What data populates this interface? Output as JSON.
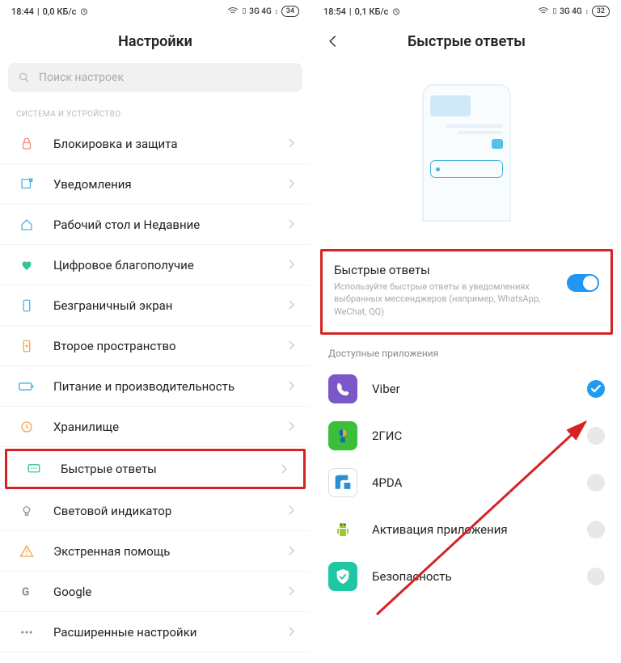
{
  "left": {
    "status": {
      "time": "18:44",
      "net": "0,0 КБ/с",
      "signals": "3G   4G",
      "battery": "34"
    },
    "title": "Настройки",
    "search_placeholder": "Поиск настроек",
    "section": "СИСТЕМА И УСТРОЙСТВО",
    "items": [
      {
        "label": "Блокировка и защита",
        "name": "settings-lock",
        "icon": "lock",
        "color": "#f08a7a"
      },
      {
        "label": "Уведомления",
        "name": "settings-notifications",
        "icon": "notif",
        "color": "#4fb8e8"
      },
      {
        "label": "Рабочий стол и Недавние",
        "name": "settings-home-recents",
        "icon": "home",
        "color": "#4fb8e8"
      },
      {
        "label": "Цифровое благополучие",
        "name": "settings-wellbeing",
        "icon": "heart",
        "color": "#2bc598"
      },
      {
        "label": "Безграничный экран",
        "name": "settings-fullscreen",
        "icon": "phone",
        "color": "#4fb8e8"
      },
      {
        "label": "Второе пространство",
        "name": "settings-second-space",
        "icon": "lock2",
        "color": "#f4a64a"
      },
      {
        "label": "Питание и производительность",
        "name": "settings-battery-perf",
        "icon": "batt",
        "color": "#4fb8e8"
      },
      {
        "label": "Хранилище",
        "name": "settings-storage",
        "icon": "store",
        "color": "#f4a64a"
      },
      {
        "label": "Быстрые ответы",
        "name": "settings-quick-replies",
        "icon": "chat",
        "color": "#2bc598",
        "highlight": true
      },
      {
        "label": "Световой индикатор",
        "name": "settings-led",
        "icon": "bulb",
        "color": "#999"
      },
      {
        "label": "Экстренная помощь",
        "name": "settings-sos",
        "icon": "warn",
        "color": "#f4a64a"
      },
      {
        "label": "Google",
        "name": "settings-google",
        "icon": "g",
        "color": "#888"
      },
      {
        "label": "Расширенные настройки",
        "name": "settings-advanced",
        "icon": "dots",
        "color": "#888"
      }
    ]
  },
  "right": {
    "status": {
      "time": "18:54",
      "net": "0,1 КБ/с",
      "signals": "3G   4G",
      "battery": "32"
    },
    "title": "Быстрые ответы",
    "toggle": {
      "title": "Быстрые ответы",
      "desc": "Используйте быстрые ответы в уведомлениях выбранных мессенджеров (например, WhatsApp, WeChat, QQ)"
    },
    "available_header": "Доступные приложения",
    "apps": [
      {
        "label": "Viber",
        "name": "app-viber",
        "bg": "#7b57c7",
        "checked": true
      },
      {
        "label": "2ГИС",
        "name": "app-2gis",
        "bg": "#3bbf3b",
        "checked": false
      },
      {
        "label": "4PDA",
        "name": "app-4pda",
        "bg": "#fff",
        "border": "#ddd",
        "checked": false
      },
      {
        "label": "Активация приложения",
        "name": "app-activation",
        "bg": "#fff",
        "checked": false
      },
      {
        "label": "Безопасность",
        "name": "app-security",
        "bg": "#1fc8a4",
        "checked": false
      }
    ]
  }
}
